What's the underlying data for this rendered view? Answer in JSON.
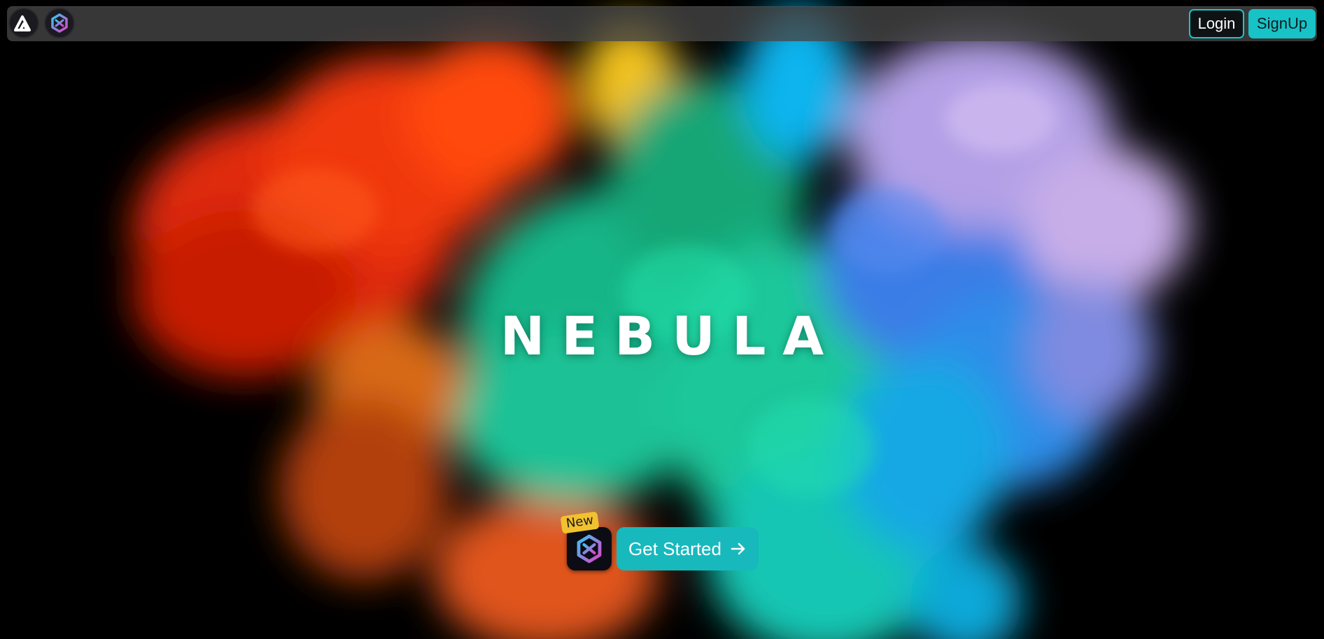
{
  "hero": {
    "title": "NEBULA"
  },
  "header": {
    "login_label": "Login",
    "signup_label": "SignUp",
    "icons": [
      "a-logo-icon",
      "nebula-logo-icon"
    ]
  },
  "cta": {
    "badge": "New",
    "button_label": "Get Started",
    "arrow_icon": "arrow-right-icon"
  },
  "colors": {
    "accent": "#17c3c7",
    "badge": "#f2c12e",
    "background": "#000000"
  }
}
